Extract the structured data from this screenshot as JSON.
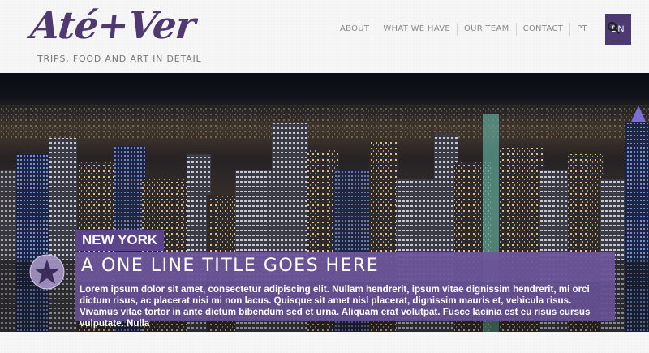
{
  "logo": {
    "text": "Até+Ver",
    "tagline": "TRIPS, FOOD AND ART IN DETAIL"
  },
  "nav": {
    "items": [
      "ABOUT",
      "WHAT WE HAVE",
      "OUR TEAM",
      "CONTACT",
      "PT"
    ],
    "active_lang": "EN",
    "accent": "#4d3a72"
  },
  "icons": {
    "search": "search-icon",
    "badge": "star-badge-icon"
  },
  "hero": {
    "city": "NEW YORK",
    "title": "A ONE LINE TITLE GOES HERE",
    "body": "Lorem ipsum dolor sit amet, consectetur adipiscing elit. Nullam hendrerit, ipsum vitae dignissim hendrerit, mi orci dictum risus, ac placerat nisi mi non lacus. Quisque sit amet nisl placerat, dignissim mauris et, vehicula risus. Vivamus vitae tortor in ante dictum bibendum sed et urna. Aliquam erat volutpat. Fusce lacinia est eu risus cursus vulputate. Nulla",
    "overlay_color": "#5b4489"
  }
}
